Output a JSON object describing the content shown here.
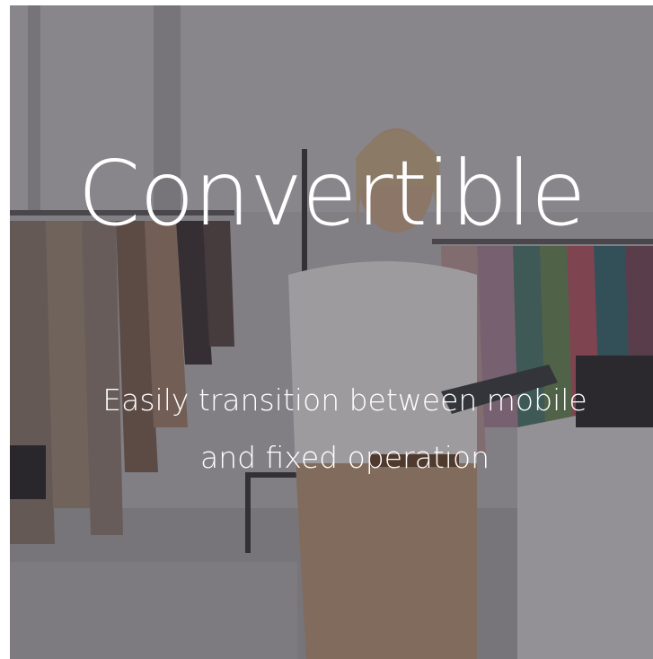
{
  "hero": {
    "headline": "Convertible",
    "subheadline": "Easily transition between mobile and fixed operation",
    "background_image": "woman-holding-tablet-in-clothing-store-photo",
    "text_color": "#ffffff",
    "overlay_color": "#28262c"
  }
}
